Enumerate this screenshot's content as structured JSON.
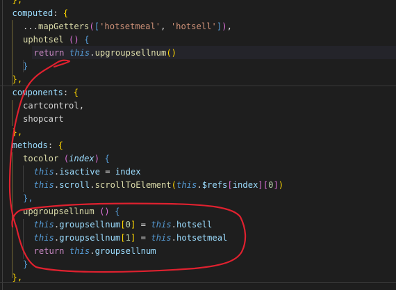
{
  "colors": {
    "background": "#1e1e1e",
    "default": "#d4d4d4",
    "brace": "#ffd700",
    "bracket": "#da70d6",
    "keyword": "#c586c0",
    "this": "#569cd6",
    "method": "#dcdcaa",
    "property": "#9cdcfe",
    "key": "#9cdcfe",
    "string": "#ce9178",
    "number": "#b5cea8",
    "annotation": "#e0212f"
  },
  "code_lines": [
    {
      "indent": 1,
      "tokens": [
        {
          "t": "},",
          "c": "brace"
        }
      ]
    },
    {
      "indent": 1,
      "tokens": [
        {
          "t": "computed",
          "c": "key"
        },
        {
          "t": ": ",
          "c": "default"
        },
        {
          "t": "{",
          "c": "brace"
        }
      ]
    },
    {
      "indent": 2,
      "tokens": [
        {
          "t": "...",
          "c": "default"
        },
        {
          "t": "mapGetters",
          "c": "method"
        },
        {
          "t": "(",
          "c": "bracket"
        },
        {
          "t": "[",
          "c": "this"
        },
        {
          "t": "'hotsetmeal'",
          "c": "string"
        },
        {
          "t": ", ",
          "c": "default"
        },
        {
          "t": "'hotsell'",
          "c": "string"
        },
        {
          "t": "]",
          "c": "this"
        },
        {
          "t": ")",
          "c": "bracket"
        },
        {
          "t": ",",
          "c": "default"
        }
      ]
    },
    {
      "indent": 2,
      "tokens": [
        {
          "t": "uphotsel",
          "c": "method"
        },
        {
          "t": " ",
          "c": "default"
        },
        {
          "t": "()",
          "c": "bracket"
        },
        {
          "t": " ",
          "c": "default"
        },
        {
          "t": "{",
          "c": "this"
        }
      ]
    },
    {
      "indent": 3,
      "tokens": [
        {
          "t": "return",
          "c": "keyword"
        },
        {
          "t": " ",
          "c": "default"
        },
        {
          "t": "this",
          "c": "this",
          "i": true
        },
        {
          "t": ".",
          "c": "default"
        },
        {
          "t": "upgroupsellnum",
          "c": "method"
        },
        {
          "t": "()",
          "c": "brace"
        }
      ]
    },
    {
      "indent": 2,
      "tokens": [
        {
          "t": "}",
          "c": "this"
        }
      ]
    },
    {
      "indent": 1,
      "tokens": [
        {
          "t": "},",
          "c": "brace"
        }
      ]
    },
    {
      "indent": 1,
      "tokens": [
        {
          "t": "components",
          "c": "key"
        },
        {
          "t": ": ",
          "c": "default"
        },
        {
          "t": "{",
          "c": "brace"
        }
      ]
    },
    {
      "indent": 2,
      "tokens": [
        {
          "t": "cartcontrol,",
          "c": "default"
        }
      ]
    },
    {
      "indent": 2,
      "tokens": [
        {
          "t": "shopcart",
          "c": "default"
        }
      ]
    },
    {
      "indent": 1,
      "tokens": [
        {
          "t": "},",
          "c": "brace"
        }
      ]
    },
    {
      "indent": 1,
      "tokens": [
        {
          "t": "methods",
          "c": "key"
        },
        {
          "t": ": ",
          "c": "default"
        },
        {
          "t": "{",
          "c": "brace"
        }
      ]
    },
    {
      "indent": 2,
      "tokens": [
        {
          "t": "tocolor",
          "c": "method"
        },
        {
          "t": " ",
          "c": "default"
        },
        {
          "t": "(",
          "c": "bracket"
        },
        {
          "t": "index",
          "c": "property",
          "i": true
        },
        {
          "t": ")",
          "c": "bracket"
        },
        {
          "t": " ",
          "c": "default"
        },
        {
          "t": "{",
          "c": "this"
        }
      ]
    },
    {
      "indent": 3,
      "tokens": [
        {
          "t": "this",
          "c": "this",
          "i": true
        },
        {
          "t": ".",
          "c": "default"
        },
        {
          "t": "isactive",
          "c": "property"
        },
        {
          "t": " = ",
          "c": "default"
        },
        {
          "t": "index",
          "c": "property"
        }
      ]
    },
    {
      "indent": 3,
      "tokens": [
        {
          "t": "this",
          "c": "this",
          "i": true
        },
        {
          "t": ".",
          "c": "default"
        },
        {
          "t": "scroll",
          "c": "property"
        },
        {
          "t": ".",
          "c": "default"
        },
        {
          "t": "scrollToElement",
          "c": "method"
        },
        {
          "t": "(",
          "c": "brace"
        },
        {
          "t": "this",
          "c": "this",
          "i": true
        },
        {
          "t": ".",
          "c": "default"
        },
        {
          "t": "$refs",
          "c": "property"
        },
        {
          "t": "[",
          "c": "bracket"
        },
        {
          "t": "index",
          "c": "property"
        },
        {
          "t": "]",
          "c": "bracket"
        },
        {
          "t": "[",
          "c": "bracket"
        },
        {
          "t": "0",
          "c": "number"
        },
        {
          "t": "]",
          "c": "bracket"
        },
        {
          "t": ")",
          "c": "brace"
        }
      ]
    },
    {
      "indent": 2,
      "tokens": [
        {
          "t": "},",
          "c": "this"
        }
      ]
    },
    {
      "indent": 2,
      "tokens": [
        {
          "t": "upgroupsellnum",
          "c": "method"
        },
        {
          "t": " ",
          "c": "default"
        },
        {
          "t": "()",
          "c": "bracket"
        },
        {
          "t": " ",
          "c": "default"
        },
        {
          "t": "{",
          "c": "this"
        }
      ]
    },
    {
      "indent": 3,
      "tokens": [
        {
          "t": "this",
          "c": "this",
          "i": true
        },
        {
          "t": ".",
          "c": "default"
        },
        {
          "t": "groupsellnum",
          "c": "property"
        },
        {
          "t": "[",
          "c": "brace"
        },
        {
          "t": "0",
          "c": "number"
        },
        {
          "t": "]",
          "c": "brace"
        },
        {
          "t": " = ",
          "c": "default"
        },
        {
          "t": "this",
          "c": "this",
          "i": true
        },
        {
          "t": ".",
          "c": "default"
        },
        {
          "t": "hotsell",
          "c": "property"
        }
      ]
    },
    {
      "indent": 3,
      "tokens": [
        {
          "t": "this",
          "c": "this",
          "i": true
        },
        {
          "t": ".",
          "c": "default"
        },
        {
          "t": "groupsellnum",
          "c": "property"
        },
        {
          "t": "[",
          "c": "brace"
        },
        {
          "t": "1",
          "c": "number"
        },
        {
          "t": "]",
          "c": "brace"
        },
        {
          "t": " = ",
          "c": "default"
        },
        {
          "t": "this",
          "c": "this",
          "i": true
        },
        {
          "t": ".",
          "c": "default"
        },
        {
          "t": "hotsetmeal",
          "c": "property"
        }
      ]
    },
    {
      "indent": 3,
      "tokens": [
        {
          "t": "return",
          "c": "keyword"
        },
        {
          "t": " ",
          "c": "default"
        },
        {
          "t": "this",
          "c": "this",
          "i": true
        },
        {
          "t": ".",
          "c": "default"
        },
        {
          "t": "groupsellnum",
          "c": "property"
        }
      ]
    },
    {
      "indent": 2,
      "tokens": [
        {
          "t": "}",
          "c": "this"
        }
      ]
    },
    {
      "indent": 1,
      "tokens": [
        {
          "t": "},",
          "c": "brace"
        }
      ]
    }
  ]
}
